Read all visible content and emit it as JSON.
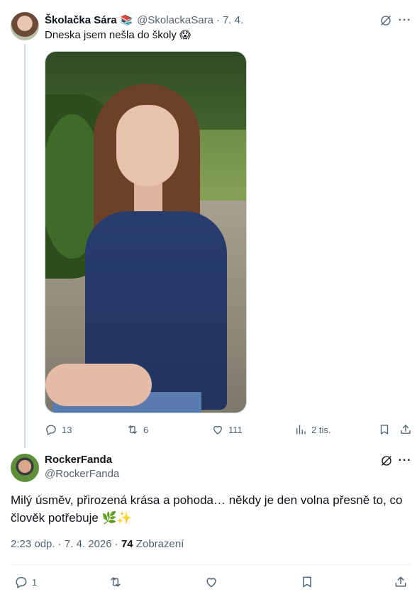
{
  "tweet": {
    "author_name": "Školačka Sára",
    "author_badge": "📚",
    "author_handle": "@SkolackaSara",
    "separator": "·",
    "date": "7. 4.",
    "text": "Dneska jsem nešla do školy 😱",
    "stats": {
      "replies": "13",
      "retweets": "6",
      "likes": "111",
      "views": "2 tis."
    }
  },
  "reply": {
    "author_name": "RockerFanda",
    "author_handle": "@RockerFanda",
    "text": "Milý úsměv, přirozená krása a pohoda… někdy je den volna přesně to, co člověk potřebuje 🌿✨",
    "timestamp": "2:23 odp. · 7. 4. 2026 · ",
    "views_count": "74",
    "views_label": " Zobrazení",
    "stats": {
      "replies": "1"
    }
  },
  "icons": {
    "reply": "speech-bubble-icon",
    "retweet": "retweet-arrows-icon",
    "like": "heart-icon",
    "views": "bar-chart-icon",
    "bookmark": "bookmark-icon",
    "share": "upload-share-icon",
    "grok": "grok-slash-icon",
    "more": "more-dots-icon"
  },
  "colors": {
    "text_primary": "#0f1419",
    "text_secondary": "#536471",
    "thread_line": "#cfd9de",
    "divider": "#eff3f4"
  }
}
